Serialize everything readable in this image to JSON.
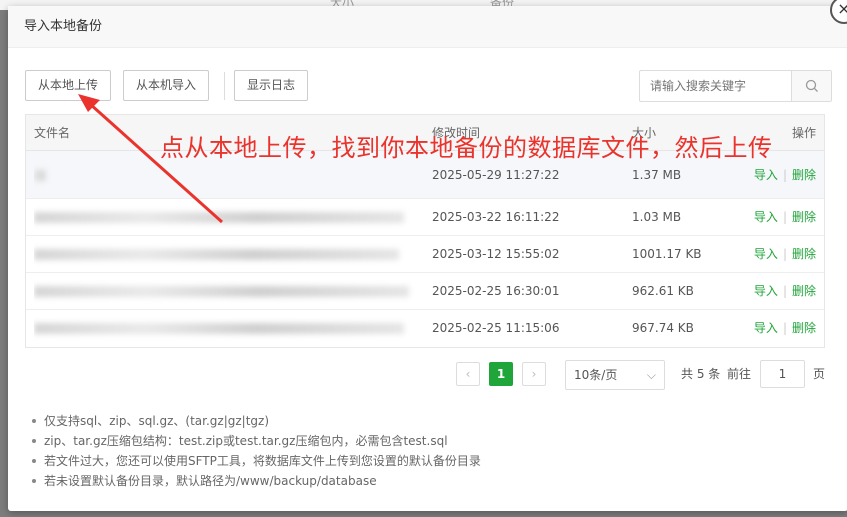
{
  "background": {
    "col1": "大小",
    "col2": "备份"
  },
  "dialog": {
    "title": "导入本地备份",
    "close_symbol": "×"
  },
  "toolbar": {
    "upload_label": "从本地上传",
    "import_label": "从本机导入",
    "log_label": "显示日志",
    "search_placeholder": "请输入搜索关键字"
  },
  "table": {
    "headers": {
      "name": "文件名",
      "time": "修改时间",
      "size": "大小",
      "op": "操作"
    },
    "rows": [
      {
        "name": "",
        "time": "2025-05-29 11:27:22",
        "size": "1.37 MB",
        "import": "导入",
        "delete": "删除"
      },
      {
        "name": "",
        "time": "2025-03-22 16:11:22",
        "size": "1.03 MB",
        "import": "导入",
        "delete": "删除"
      },
      {
        "name": "",
        "time": "2025-03-12 15:55:02",
        "size": "1001.17 KB",
        "import": "导入",
        "delete": "删除"
      },
      {
        "name": "",
        "time": "2025-02-25 16:30:01",
        "size": "962.61 KB",
        "import": "导入",
        "delete": "删除"
      },
      {
        "name": "",
        "time": "2025-02-25 11:15:06",
        "size": "967.74 KB",
        "import": "导入",
        "delete": "删除"
      }
    ],
    "link_separator": "|"
  },
  "annotation": "点从本地上传，找到你本地备份的数据库文件，然后上传",
  "pagination": {
    "prev": "‹",
    "current": "1",
    "next": "›",
    "page_size": "10条/页",
    "total": "共 5 条",
    "goto_label": "前往",
    "goto_value": "1",
    "page_unit": "页"
  },
  "notes": [
    "仅支持sql、zip、sql.gz、(tar.gz|gz|tgz)",
    "zip、tar.gz压缩包结构：test.zip或test.tar.gz压缩包内，必需包含test.sql",
    "若文件过大，您还可以使用SFTP工具，将数据库文件上传到您设置的默认备份目录",
    "若未设置默认备份目录，默认路径为/www/backup/database"
  ],
  "colors": {
    "accent": "#20a53a",
    "annotation": "#e9332c"
  }
}
